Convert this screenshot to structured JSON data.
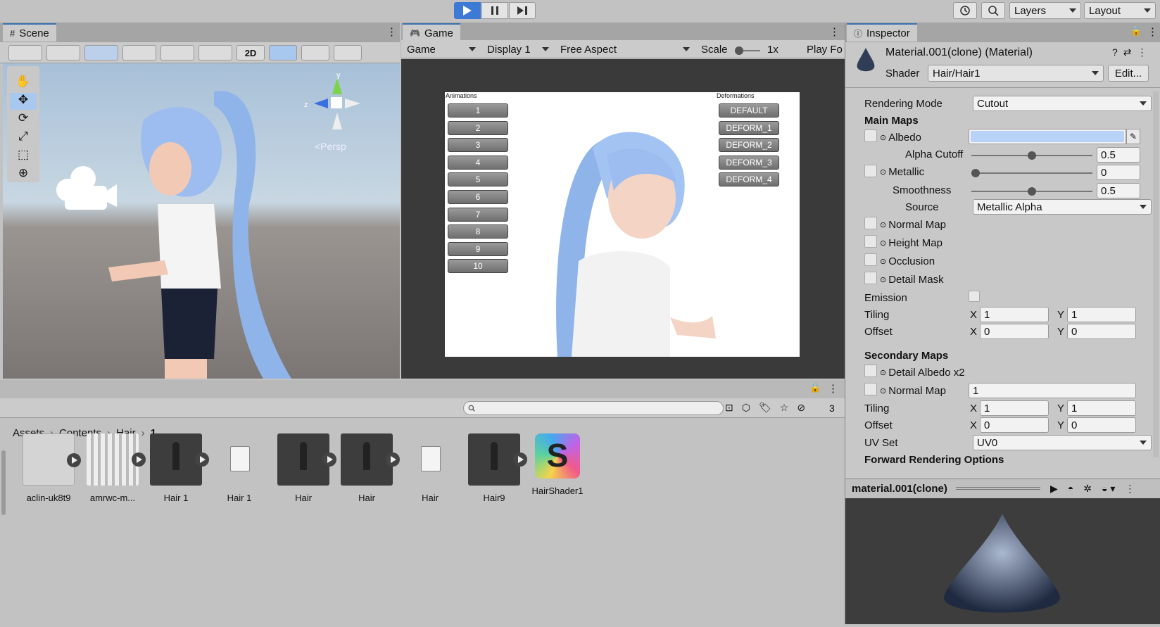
{
  "top": {
    "layers_label": "Layers",
    "layout_label": "Layout"
  },
  "scene": {
    "tab_label": "Scene",
    "mode_2d": "2D",
    "persp_label": "<Persp",
    "axis_y": "y",
    "axis_z": "z"
  },
  "game": {
    "tab_label": "Game",
    "display_mode": "Game",
    "display": "Display 1",
    "aspect": "Free Aspect",
    "scale_label": "Scale",
    "scale_value": "1x",
    "play_focused": "Play Fo",
    "animations_title": "Animations",
    "deformations_title": "Deformations",
    "animations": [
      "1",
      "2",
      "3",
      "4",
      "5",
      "6",
      "7",
      "8",
      "9",
      "10"
    ],
    "deformations": [
      "DEFAULT",
      "DEFORM_1",
      "DEFORM_2",
      "DEFORM_3",
      "DEFORM_4"
    ]
  },
  "project": {
    "breadcrumb": [
      "Assets",
      "Contents",
      "Hair",
      "1"
    ],
    "hidden_count": "3",
    "assets": [
      {
        "label": "aclin-uk8t9",
        "kind": "mesh-light"
      },
      {
        "label": "amrwc-m...",
        "kind": "texture"
      },
      {
        "label": "Hair 1",
        "kind": "model-dark"
      },
      {
        "label": "Hair 1",
        "kind": "file"
      },
      {
        "label": "Hair",
        "kind": "model-dark"
      },
      {
        "label": "Hair",
        "kind": "model-dark"
      },
      {
        "label": "Hair",
        "kind": "file"
      },
      {
        "label": "Hair9",
        "kind": "model-dark"
      },
      {
        "label": "HairShader1",
        "kind": "shader"
      }
    ]
  },
  "inspector": {
    "tab_label": "Inspector",
    "title": "Material.001(clone) (Material)",
    "shader_label": "Shader",
    "shader_value": "Hair/Hair1",
    "edit_label": "Edit...",
    "rendering_mode_label": "Rendering Mode",
    "rendering_mode_value": "Cutout",
    "main_maps": "Main Maps",
    "albedo": "Albedo",
    "albedo_color": "#b9d3f8",
    "alpha_cutoff": "Alpha Cutoff",
    "alpha_cutoff_value": "0.5",
    "metallic": "Metallic",
    "metallic_value": "0",
    "smoothness": "Smoothness",
    "smoothness_value": "0.5",
    "source": "Source",
    "source_value": "Metallic Alpha",
    "normal_map": "Normal Map",
    "height_map": "Height Map",
    "occlusion": "Occlusion",
    "detail_mask": "Detail Mask",
    "emission": "Emission",
    "tiling": "Tiling",
    "offset": "Offset",
    "tiling_x": "1",
    "tiling_y": "1",
    "offset_x": "0",
    "offset_y": "0",
    "secondary_maps": "Secondary Maps",
    "detail_albedo": "Detail Albedo x2",
    "normal_map2": "Normal Map",
    "normal_map2_value": "1",
    "tiling2_x": "1",
    "tiling2_y": "1",
    "offset2_x": "0",
    "offset2_y": "0",
    "uv_set": "UV Set",
    "uv_set_value": "UV0",
    "forward_opts": "Forward Rendering Options",
    "x": "X",
    "y": "Y",
    "preview_name": "material.001(clone)"
  }
}
